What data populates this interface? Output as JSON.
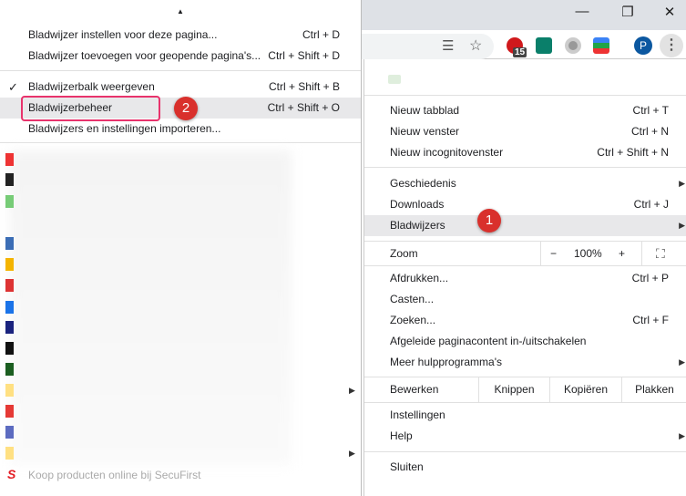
{
  "window": {
    "minimize": "—",
    "restore": "❐",
    "close": "✕"
  },
  "toolbar": {
    "badge_count": "15",
    "avatar_initial": "P"
  },
  "submenu": {
    "items": [
      {
        "label": "Bladwijzer instellen voor deze pagina...",
        "shortcut": "Ctrl + D"
      },
      {
        "label": "Bladwijzer toevoegen voor geopende pagina's...",
        "shortcut": "Ctrl + Shift + D"
      },
      {
        "label": "Bladwijzerbalk weergeven",
        "shortcut": "Ctrl + Shift + B",
        "checked": true
      },
      {
        "label": "Bladwijzerbeheer",
        "shortcut": "Ctrl + Shift + O"
      },
      {
        "label": "Bladwijzers en instellingen importeren..."
      }
    ],
    "last_bookmark": "Koop producten online bij SecuFirst",
    "step_badge": "2"
  },
  "menu": {
    "new": [
      {
        "label": "Nieuw tabblad",
        "shortcut": "Ctrl + T"
      },
      {
        "label": "Nieuw venster",
        "shortcut": "Ctrl + N"
      },
      {
        "label": "Nieuw incognitovenster",
        "shortcut": "Ctrl + Shift + N"
      }
    ],
    "history": [
      {
        "label": "Geschiedenis"
      },
      {
        "label": "Downloads",
        "shortcut": "Ctrl + J"
      },
      {
        "label": "Bladwijzers"
      }
    ],
    "step_badge": "1",
    "zoom": {
      "label": "Zoom",
      "minus": "−",
      "value": "100%",
      "plus": "+"
    },
    "tools": [
      {
        "label": "Afdrukken...",
        "shortcut": "Ctrl + P"
      },
      {
        "label": "Casten..."
      },
      {
        "label": "Zoeken...",
        "shortcut": "Ctrl + F"
      },
      {
        "label": "Afgeleide paginacontent in-/uitschakelen"
      },
      {
        "label": "Meer hulpprogramma's"
      }
    ],
    "edit": {
      "label": "Bewerken",
      "cut": "Knippen",
      "copy": "Kopiëren",
      "paste": "Plakken"
    },
    "settings": {
      "label": "Instellingen"
    },
    "help": {
      "label": "Help"
    },
    "exit": {
      "label": "Sluiten"
    }
  }
}
